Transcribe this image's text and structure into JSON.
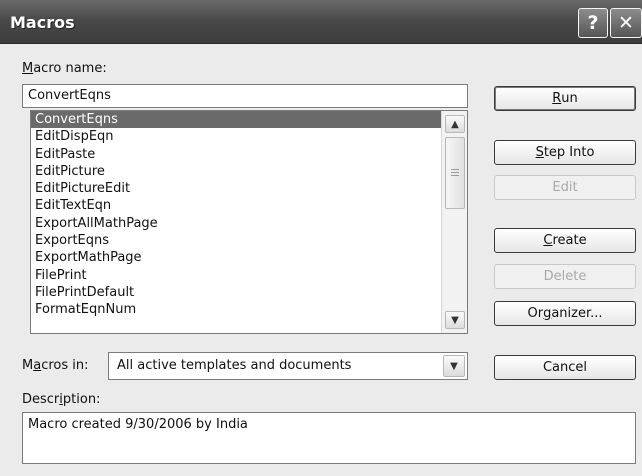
{
  "title": "Macros",
  "title_buttons": {
    "help": "?",
    "close": "✕"
  },
  "macro_name": {
    "label_prefix": "",
    "label_mnemonic": "M",
    "label_suffix": "acro name:",
    "value": "ConvertEqns"
  },
  "macro_list": {
    "items": [
      "ConvertEqns",
      "EditDispEqn",
      "EditPaste",
      "EditPicture",
      "EditPictureEdit",
      "EditTextEqn",
      "ExportAllMathPage",
      "ExportEqns",
      "ExportMathPage",
      "FilePrint",
      "FilePrintDefault",
      "FormatEqnNum"
    ],
    "selected_index": 0,
    "scroll_up_icon": "▲",
    "scroll_down_icon": "▼"
  },
  "buttons": {
    "run": {
      "prefix": "",
      "mnemonic": "R",
      "suffix": "un"
    },
    "step_into": {
      "prefix": "",
      "mnemonic": "S",
      "suffix": "tep Into"
    },
    "edit": {
      "prefix": "",
      "mnemonic": "",
      "suffix": "Edit"
    },
    "create": {
      "prefix": "",
      "mnemonic": "C",
      "suffix": "reate"
    },
    "delete": {
      "prefix": "",
      "mnemonic": "",
      "suffix": "Delete"
    },
    "organizer": {
      "prefix": "Or",
      "mnemonic": "g",
      "suffix": "anizer..."
    },
    "cancel": {
      "prefix": "",
      "mnemonic": "",
      "suffix": "Cancel"
    }
  },
  "macros_in": {
    "label_prefix": "M",
    "label_mnemonic": "a",
    "label_suffix": "cros in:",
    "value": "All active templates and documents",
    "arrow_icon": "▼"
  },
  "description": {
    "label_prefix": "Descr",
    "label_mnemonic": "i",
    "label_suffix": "ption:",
    "value": "Macro created 9/30/2006 by India"
  }
}
